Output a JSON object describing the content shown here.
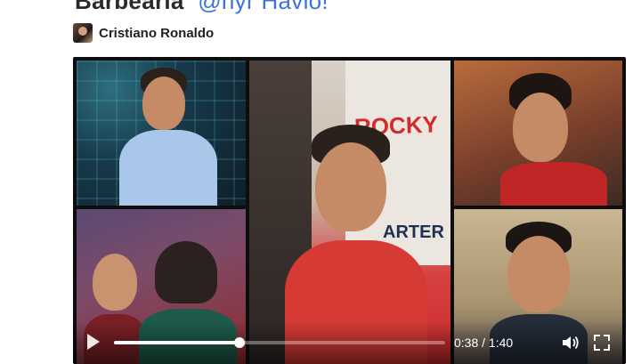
{
  "post": {
    "title_text": "Barbearia",
    "title_link": "@nyr Havlo!",
    "author": "Cristiano Ronaldo"
  },
  "video": {
    "current_time": "0:38",
    "time_separator": " / ",
    "duration": "1:40",
    "progress": 0.38,
    "icons": {
      "play": "play-icon",
      "volume": "volume-icon",
      "fullscreen": "fullscreen-icon"
    },
    "shirt_text": "ROCKY",
    "shirt_text_2": "ARTER"
  }
}
